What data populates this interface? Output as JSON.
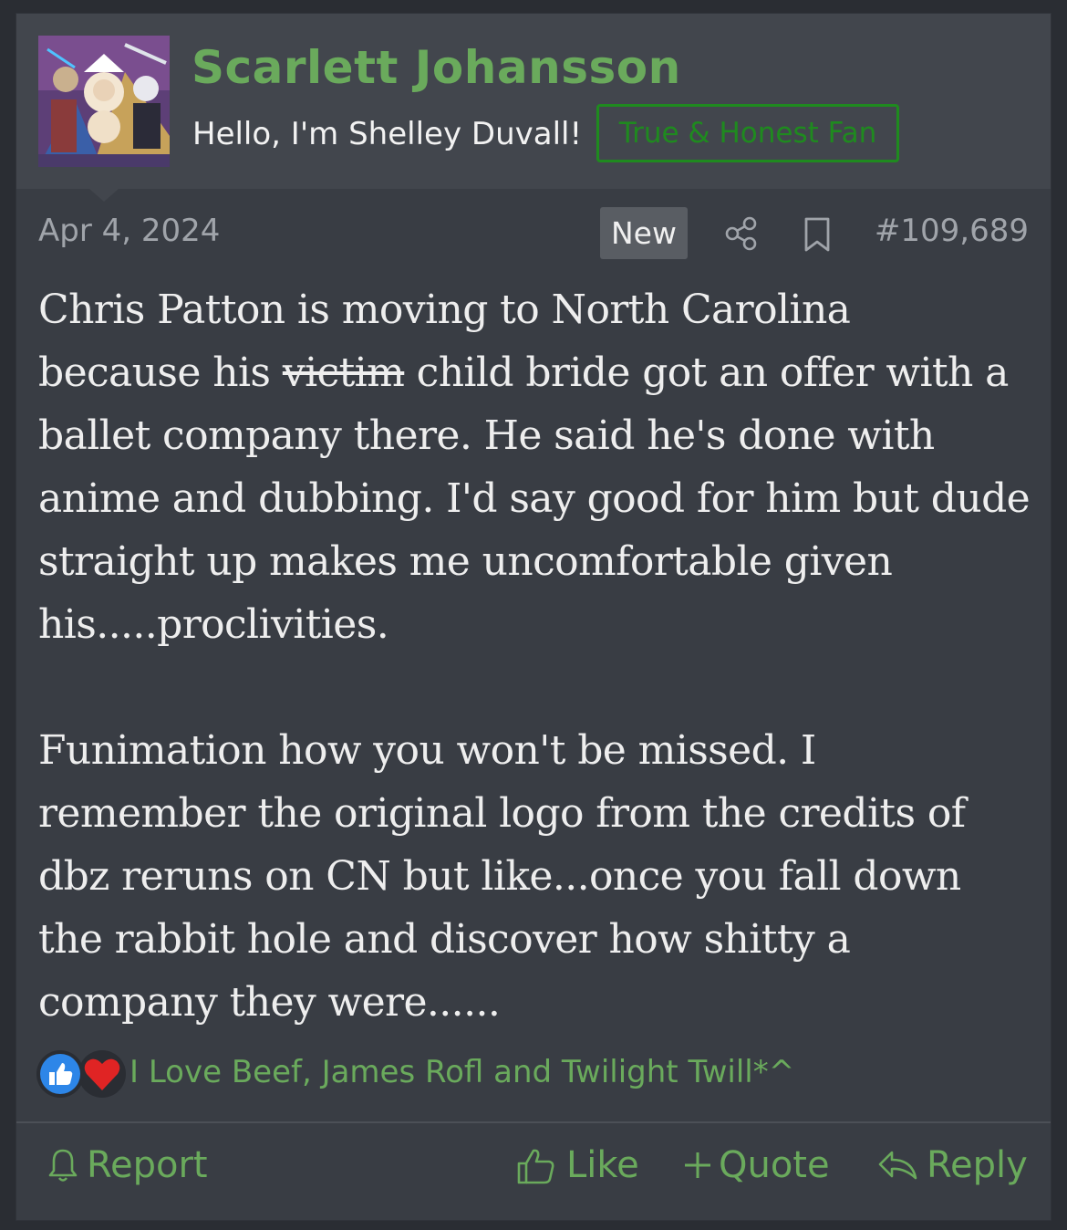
{
  "post": {
    "author": {
      "name": "Scarlett Johansson",
      "custom_title": "Hello, I'm Shelley Duvall!",
      "badge": "True & Honest Fan",
      "avatar_icon": "comic-artwork-avatar"
    },
    "date": "Apr 4, 2024",
    "new_label": "New",
    "post_number": "#109,689",
    "icons": {
      "share": "share-icon",
      "bookmark": "bookmark-icon"
    },
    "message": {
      "p1_line1": "Chris Patton is moving to North Carolina",
      "p1_line2_before": "because his ",
      "p1_line2_struck": "victim",
      "p1_line2_after": " child bride got an offer with a",
      "p1_rest": "ballet company there. He said he's done with anime and dubbing. I'd say good for him but dude straight up makes me uncomfortable given his.....proclivities.",
      "p2": "Funimation how you won't be missed. I remember the original logo from the credits of dbz reruns on CN but like...once you fall down the rabbit hole and discover how shitty a company they were......"
    },
    "reactions": {
      "types": [
        "like-reaction-icon",
        "love-reaction-icon"
      ],
      "users": "I Love Beef, James Rofl and Twilight Twill*^"
    },
    "actions": {
      "report": "Report",
      "like": "Like",
      "quote": "Quote",
      "reply": "Reply"
    },
    "colors": {
      "accent_green": "#6aaa5c",
      "badge_green": "#1f8a1f",
      "background": "#393d44",
      "header": "#42464d"
    }
  }
}
